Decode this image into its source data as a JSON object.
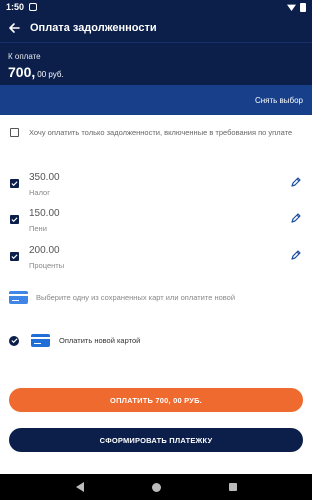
{
  "status_bar": {
    "time": "1:50"
  },
  "appbar": {
    "title": "Оплата задолженности"
  },
  "summary": {
    "label": "К оплате",
    "amount_main": "700,",
    "amount_rest": "00 руб."
  },
  "actions": {
    "clear_selection": "Снять выбор"
  },
  "only_debt_option": {
    "label": "Хочу оплатить только задолженности, включенные в требования по уплате",
    "checked": false
  },
  "items": [
    {
      "amount": "350.00",
      "kind": "Налог",
      "checked": true
    },
    {
      "amount": "150.00",
      "kind": "Пени",
      "checked": true
    },
    {
      "amount": "200.00",
      "kind": "Проценты",
      "checked": true
    }
  ],
  "saved_cards": {
    "text": "Выберите одну из сохраненных карт или оплатите новой"
  },
  "new_card": {
    "label": "Оплатить новой картой",
    "selected": true
  },
  "buttons": {
    "pay": "ОПЛАТИТЬ 700, 00 РУБ.",
    "form_payment": "СФОРМИРОВАТЬ ПЛАТЕЖКУ"
  },
  "colors": {
    "primary": "#0b1f4a",
    "accent_blue": "#173f8a",
    "pay_button": "#ef6a2f",
    "card_icon": "#1f6fd6"
  }
}
